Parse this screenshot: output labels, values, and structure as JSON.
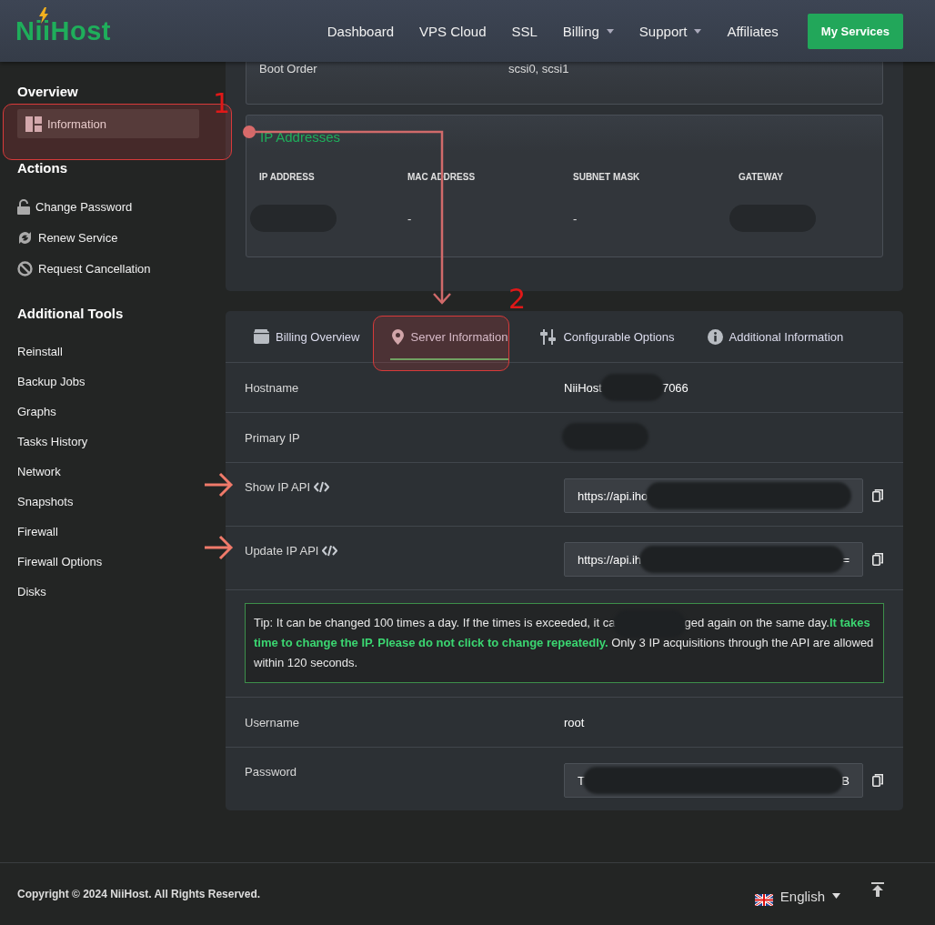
{
  "header": {
    "logo": "NiiHost",
    "nav": [
      {
        "label": "Dashboard",
        "dropdown": false
      },
      {
        "label": "VPS Cloud",
        "dropdown": false
      },
      {
        "label": "SSL",
        "dropdown": false
      },
      {
        "label": "Billing",
        "dropdown": true
      },
      {
        "label": "Support",
        "dropdown": true
      },
      {
        "label": "Affiliates",
        "dropdown": false
      }
    ],
    "cta": "My Services"
  },
  "sidebar": {
    "sections": [
      {
        "title": "Overview",
        "items": [
          {
            "label": "Information",
            "selected": true
          }
        ]
      },
      {
        "title": "Actions",
        "items": [
          {
            "label": "Change Password",
            "selected": false
          },
          {
            "label": "Renew Service",
            "selected": false
          },
          {
            "label": "Request Cancellation",
            "selected": false
          }
        ]
      },
      {
        "title": "Additional Tools",
        "items": [
          {
            "label": "Reinstall",
            "selected": false
          },
          {
            "label": "Backup Jobs",
            "selected": false
          },
          {
            "label": "Graphs",
            "selected": false
          },
          {
            "label": "Tasks History",
            "selected": false
          },
          {
            "label": "Network",
            "selected": false
          },
          {
            "label": "Snapshots",
            "selected": false
          },
          {
            "label": "Firewall",
            "selected": false
          },
          {
            "label": "Firewall Options",
            "selected": false
          },
          {
            "label": "Disks",
            "selected": false
          }
        ]
      }
    ]
  },
  "details_card": {
    "rows": [
      {
        "label": "Boot Order",
        "value": "scsi0, scsi1"
      }
    ]
  },
  "ip_addresses": {
    "title": "IP Addresses",
    "columns": [
      "IP ADDRESS",
      "MAC ADDRESS",
      "SUBNET MASK",
      "GATEWAY"
    ],
    "rows": [
      {
        "cells": [
          {
            "kind": "redacted"
          },
          {
            "kind": "text",
            "text": "-"
          },
          {
            "kind": "text",
            "text": "-"
          },
          {
            "kind": "redacted"
          }
        ]
      }
    ]
  },
  "tabs": [
    {
      "label": "Billing Overview",
      "selected": false
    },
    {
      "label": "Server Information",
      "selected": true
    },
    {
      "label": "Configurable Options",
      "selected": false
    },
    {
      "label": "Additional Information",
      "selected": false
    }
  ],
  "server_info": {
    "rows": [
      {
        "kind": "text",
        "label": "Hostname",
        "value": [
          {
            "kind": "text",
            "text": "NiiHost"
          },
          {
            "kind": "redacted"
          },
          {
            "kind": "text",
            "text": "7066"
          }
        ]
      },
      {
        "kind": "text",
        "label": "Primary IP",
        "value": [
          {
            "kind": "redacted"
          }
        ]
      },
      {
        "kind": "copy_field",
        "label": "Show IP API",
        "code_icon": true,
        "value": [
          {
            "kind": "text",
            "text": "https://api.iho"
          },
          {
            "kind": "redacted"
          }
        ]
      },
      {
        "kind": "copy_field",
        "label": "Update IP API",
        "code_icon": true,
        "value": [
          {
            "kind": "text",
            "text": "https://api.ih"
          },
          {
            "kind": "redacted"
          },
          {
            "kind": "text",
            "text": "="
          }
        ]
      },
      {
        "kind": "tip",
        "value": [
          {
            "kind": "text",
            "text": "Tip: It can be changed 100 times a day. If the times is exceeded, it ca"
          },
          {
            "kind": "redacted"
          },
          {
            "kind": "text",
            "text": "ged again on the same day.**It takes time to change the IP. Please do not click to change repeatedly.** Only 3 IP acquisitions through the API are allowed within 120 seconds."
          }
        ]
      },
      {
        "kind": "text",
        "label": "Username",
        "value": [
          {
            "kind": "text",
            "text": "root"
          }
        ]
      },
      {
        "kind": "copy_field",
        "label": "Password",
        "value": [
          {
            "kind": "text",
            "text": "T"
          },
          {
            "kind": "redacted"
          },
          {
            "kind": "text",
            "text": "B"
          }
        ]
      }
    ]
  },
  "footer": {
    "copyright": "Copyright © 2024 NiiHost. All Rights Reserved.",
    "language": "English"
  },
  "annotations": [
    {
      "label": "1"
    },
    {
      "label": "2"
    }
  ]
}
